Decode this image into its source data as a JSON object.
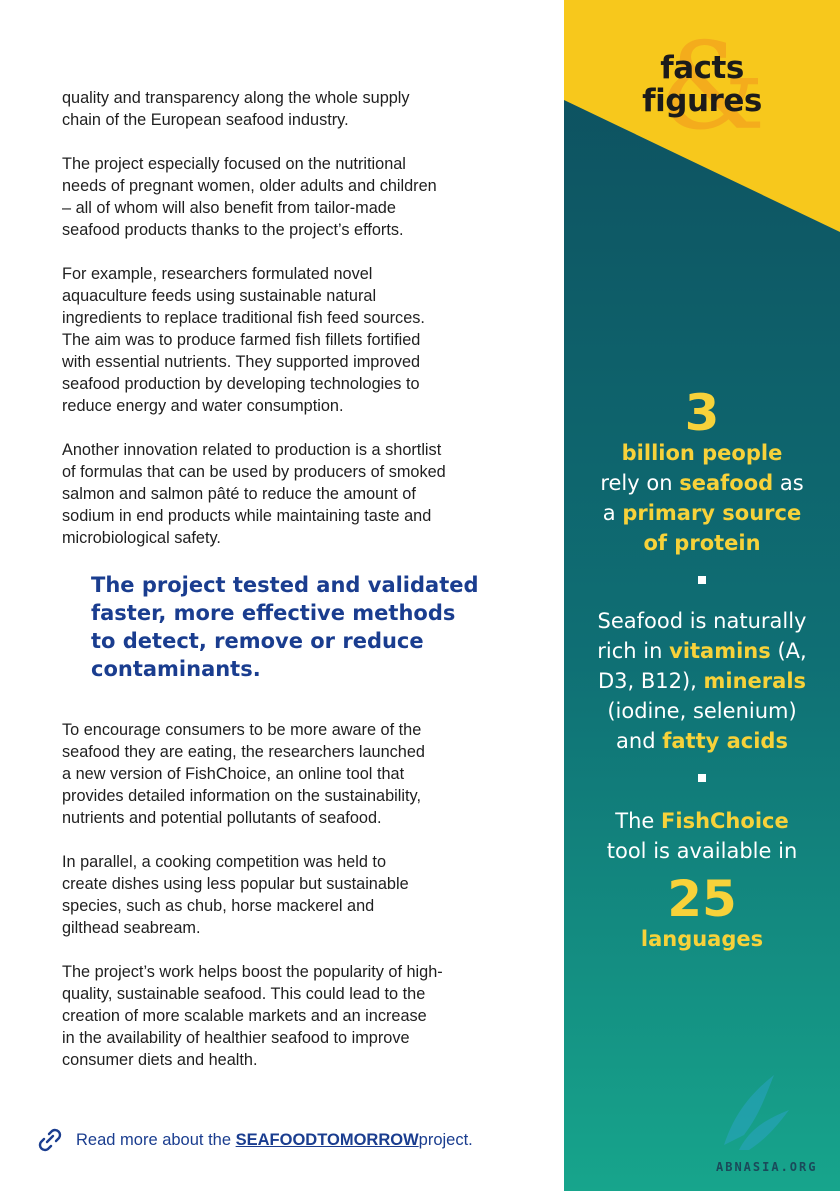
{
  "main": {
    "paragraphs": [
      "quality and transparency along the whole supply\nchain of the European seafood industry.",
      "The project especially focused on the nutritional\nneeds of pregnant women, older adults and children\n– all of whom will also benefit from tailor-made\nseafood products thanks to the project’s efforts.",
      "For example, researchers formulated novel\naquaculture feeds using sustainable natural\ningredients to replace traditional fish feed sources.\nThe aim was to produce farmed fish fillets fortified\nwith essential nutrients. They supported improved\nseafood production by developing technologies to\nreduce energy and water consumption.",
      "Another innovation related to production is a shortlist\nof formulas that can be used by producers of smoked\nsalmon and salmon pâté to reduce the amount of\nsodium in end products while maintaining taste and\nmicrobiological safety."
    ],
    "quote": "The project tested and validated\nfaster, more effective methods\nto detect, remove or reduce\ncontaminants.",
    "paragraphs2": [
      "To encourage consumers to be more aware of the\nseafood they are eating, the researchers launched\na new version of FishChoice, an online tool that\nprovides detailed information on the sustainability,\nnutrients and potential pollutants of seafood.",
      "In parallel, a cooking competition was held to\ncreate dishes using less popular but sustainable\nspecies, such as chub, horse mackerel and\ngilthead seabream.",
      "The project’s work helps boost the popularity of high-\nquality, sustainable seafood. This could lead to the\ncreation of more scalable markets and an increase\nin the availability of healthier seafood to improve\nconsumer diets and health."
    ],
    "read_more": {
      "prefix": "Read more about the ",
      "link": "SEAFOODTOMORROW",
      "suffix": " project."
    }
  },
  "sidebar": {
    "title_line1": "facts",
    "title_line2": "figures",
    "amp": "&",
    "fact1": {
      "number": "3",
      "line1": "billion people",
      "rely": "rely on ",
      "seafood": "seafood",
      "as": " as",
      "a": "a ",
      "primary": "primary source",
      "protein": "of protein"
    },
    "fact2": {
      "pre": "Seafood is naturally",
      "rich": "rich in ",
      "vitamins": "vitamins",
      "a_paren": " (A,",
      "d3": "D3, B12), ",
      "minerals": "minerals",
      "iodine": "(iodine, selenium)",
      "and": "and ",
      "fatty": "fatty acids"
    },
    "fact3": {
      "the": "The ",
      "fishchoice": "FishChoice",
      "tool": "tool is available in",
      "number": "25",
      "languages": "languages"
    },
    "watermark": "ABNASIA.ORG"
  },
  "colors": {
    "yellow": "#f7c81c",
    "teal_dark": "#0e5560",
    "teal_light": "#14a08a",
    "highlight": "#f7d23a",
    "quote_blue": "#1a3d8f"
  }
}
